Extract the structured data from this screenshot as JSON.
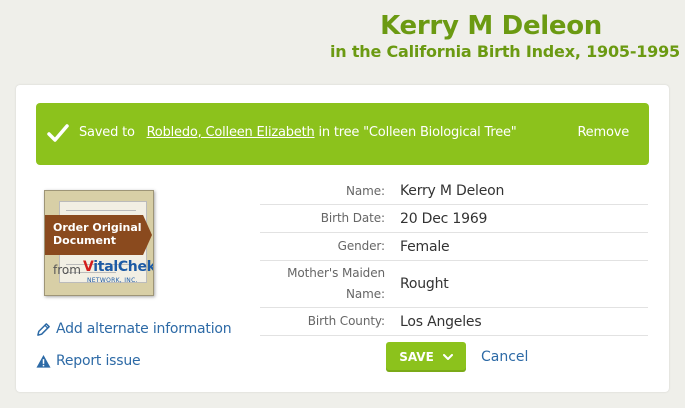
{
  "header": {
    "title": "Kerry M Deleon",
    "subtitle": "in the California Birth Index, 1905-1995"
  },
  "saved_banner": {
    "prefix": "Saved to",
    "person_link": "Robledo, Colleen Elizabeth",
    "suffix": "in tree \"Colleen Biological Tree\"",
    "remove_label": "Remove",
    "icon": "checkmark-icon"
  },
  "document": {
    "banner_line1": "Order Original",
    "banner_line2": "Document",
    "from_label": "from",
    "brand_v": "V",
    "brand_rest": "italChek",
    "brand_sub": "NETWORK, INC."
  },
  "side_links": {
    "add_info": "Add alternate information",
    "report": "Report issue"
  },
  "record": {
    "fields": [
      {
        "label": "Name:",
        "value": "Kerry M Deleon"
      },
      {
        "label": "Birth Date:",
        "value": "20 Dec 1969"
      },
      {
        "label": "Gender:",
        "value": "Female"
      },
      {
        "label": "Mother's Maiden Name:",
        "value": "Rought"
      },
      {
        "label": "Birth County:",
        "value": "Los Angeles"
      }
    ]
  },
  "actions": {
    "save_label": "SAVE",
    "cancel_label": "Cancel"
  },
  "colors": {
    "accent_green": "#8cc21c",
    "title_green": "#6b9a12",
    "link_blue": "#2d6aa6"
  }
}
